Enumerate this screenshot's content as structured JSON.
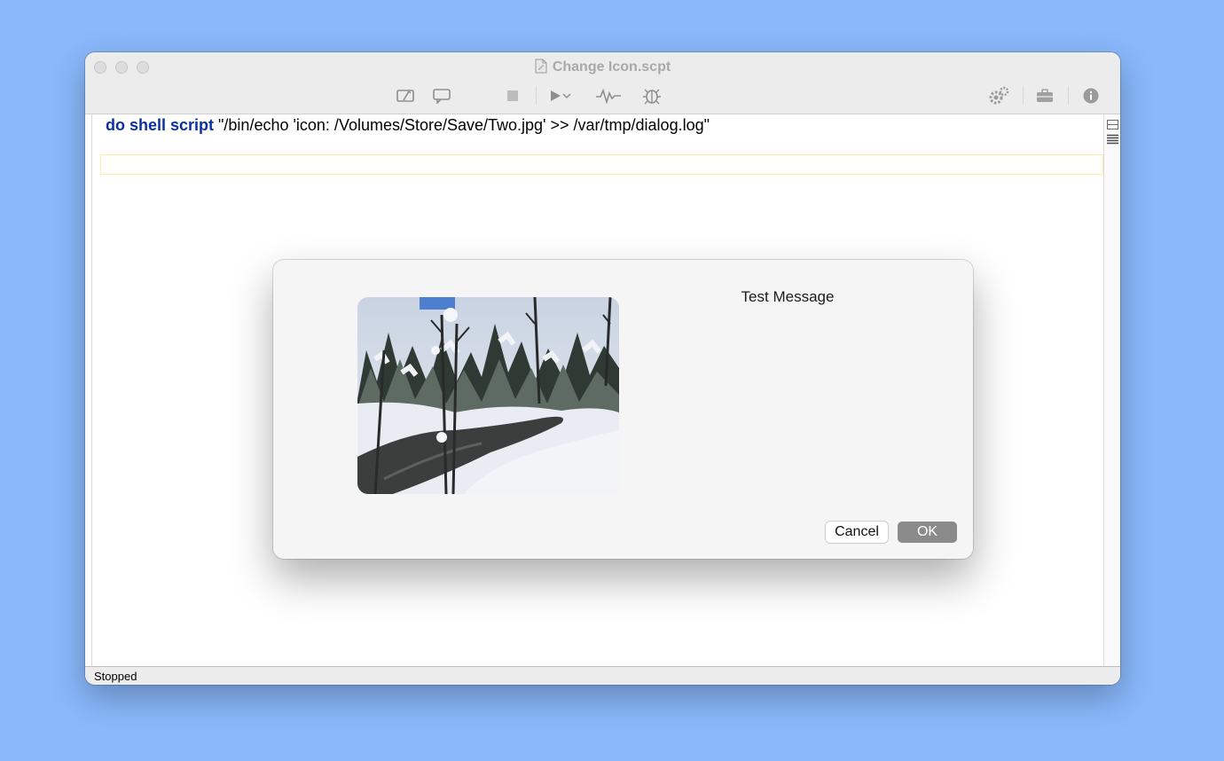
{
  "window": {
    "title": "Change Icon.scpt",
    "toolbar_icons": [
      "compile-icon",
      "comment-icon",
      "stop-icon",
      "run-icon",
      "chevron-down-icon",
      "waveform-icon",
      "bug-icon",
      "gear-icon",
      "briefcase-icon",
      "info-icon"
    ]
  },
  "editor": {
    "code_keyword": "do shell script",
    "code_string": " \"/bin/echo 'icon: /Volumes/Store/Save/Two.jpg' >> /var/tmp/dialog.log\""
  },
  "dialog": {
    "message": "Test Message",
    "cancel_label": "Cancel",
    "ok_label": "OK"
  },
  "status": {
    "text": "Stopped"
  },
  "colors": {
    "desktop": "#89b8fb",
    "keyword": "#0b2fa6",
    "ok_button": "#8a8a8a"
  }
}
